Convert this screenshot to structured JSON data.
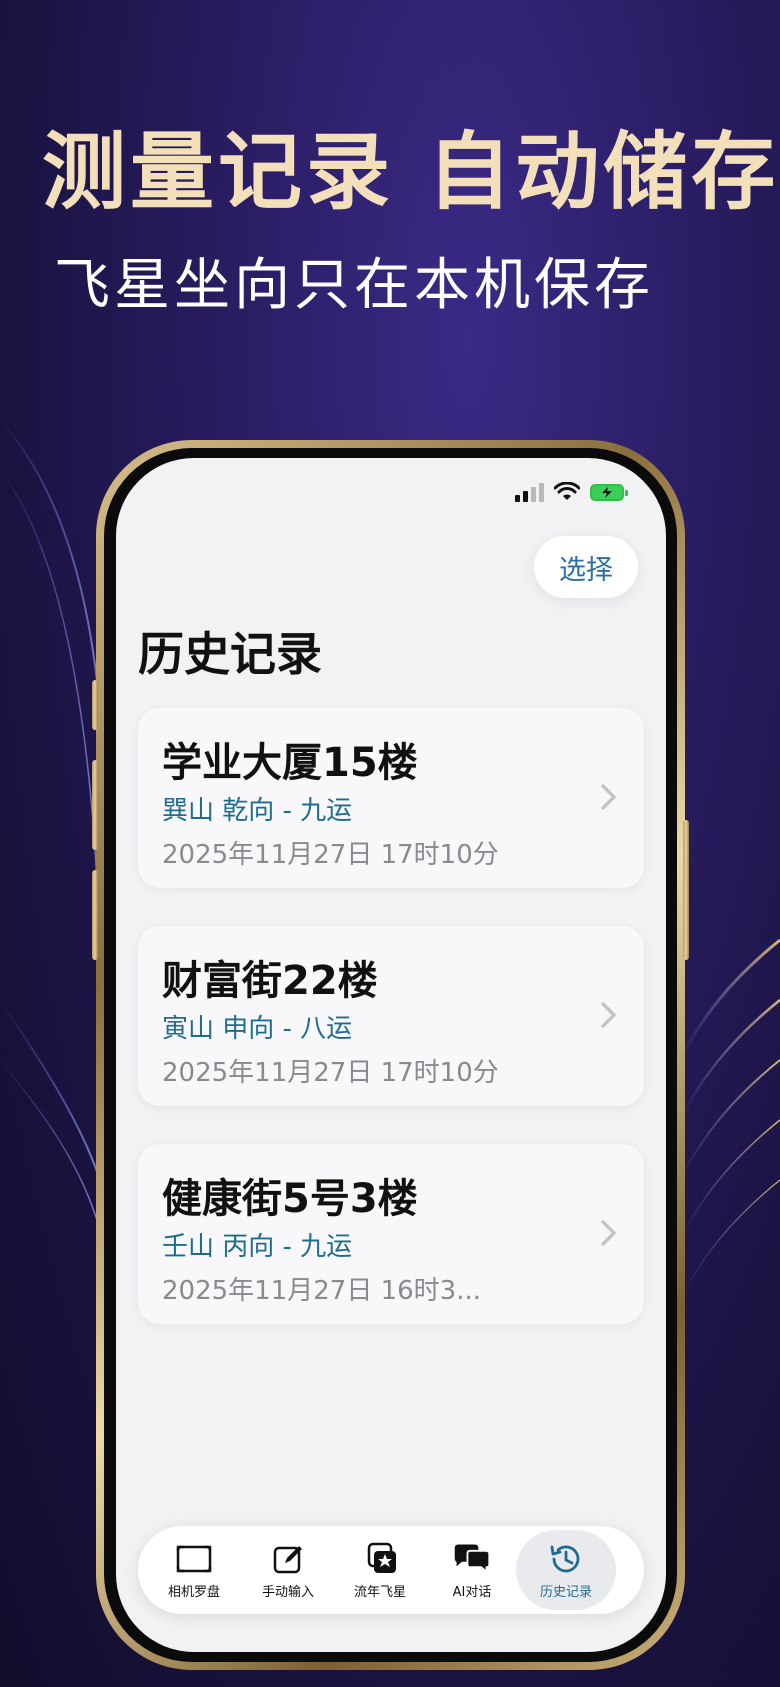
{
  "promo": {
    "headline": "测量记录  自动储存",
    "subheadline": "飞星坐向只在本机保存"
  },
  "header": {
    "select_label": "选择",
    "title": "历史记录"
  },
  "records": [
    {
      "name": "学业大厦15楼",
      "direction": "巽山 乾向 - 九运",
      "time": "2025年11月27日 17时10分"
    },
    {
      "name": "财富街22楼",
      "direction": "寅山 申向 - 八运",
      "time": "2025年11月27日 17时10分"
    },
    {
      "name": "健康街5号3楼",
      "direction": "壬山 丙向 - 九运",
      "time": "2025年11月27日 16时3..."
    }
  ],
  "tabs": [
    {
      "label": "相机罗盘",
      "icon": "camera-frame-icon"
    },
    {
      "label": "手动输入",
      "icon": "edit-icon"
    },
    {
      "label": "流年飞星",
      "icon": "star-cards-icon"
    },
    {
      "label": "AI对话",
      "icon": "chat-bubbles-icon"
    },
    {
      "label": "历史记录",
      "icon": "history-clock-icon",
      "active": true
    }
  ],
  "colors": {
    "accent": "#1f6c91",
    "headline": "#f3dfb9",
    "battery": "#3ccf57"
  }
}
